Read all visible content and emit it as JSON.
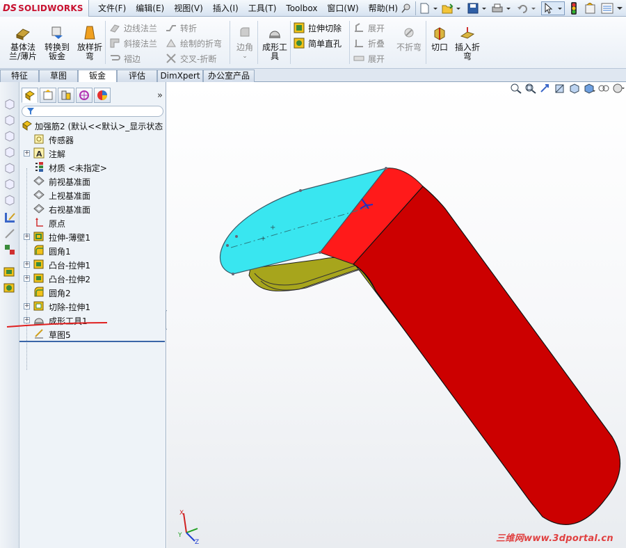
{
  "app": {
    "logo_ds": "DS",
    "logo_name": "SOLIDWORKS"
  },
  "menu": [
    "文件(F)",
    "编辑(E)",
    "视图(V)",
    "插入(I)",
    "工具(T)",
    "Toolbox",
    "窗口(W)",
    "帮助(H)"
  ],
  "commands": {
    "big": [
      {
        "label": "基体法\n兰/薄片",
        "icon": "base-flange-icon"
      },
      {
        "label": "转换到\n钣金",
        "icon": "convert-to-sheet-metal-icon"
      },
      {
        "label": "放样折\n弯",
        "icon": "lofted-bend-icon"
      },
      {
        "label": "边角",
        "icon": "corners-icon"
      },
      {
        "label": "成形工\n具",
        "icon": "forming-tool-icon"
      },
      {
        "label": "切口",
        "icon": "rip-icon"
      },
      {
        "label": "插入折\n弯",
        "icon": "insert-bends-icon"
      }
    ],
    "small": {
      "edge_flange": "边线法兰",
      "miter_flange": "斜接法兰",
      "hem": "褶边",
      "jog": "转折",
      "sketched_bend": "绘制的折弯",
      "cross_break": "交叉-折断",
      "extruded_cut": "拉伸切除",
      "simple_hole": "简单直孔",
      "unfold": "展开",
      "fold": "折叠",
      "flatten": "展开",
      "no_bends": "不折弯"
    }
  },
  "tabs": [
    "特征",
    "草图",
    "钣金",
    "评估",
    "DimXpert",
    "办公室产品"
  ],
  "active_tab": "钣金",
  "feature_tree": {
    "expand_glyph": "»",
    "root": "加强筋2 (默认<<默认>_显示状态",
    "items": [
      {
        "label": "传感器",
        "icon": "sensor-icon",
        "expandable": false
      },
      {
        "label": "注解",
        "icon": "annotation-icon",
        "expandable": true
      },
      {
        "label": "材质 <未指定>",
        "icon": "material-icon",
        "expandable": false
      },
      {
        "label": "前视基准面",
        "icon": "plane-icon",
        "expandable": false
      },
      {
        "label": "上视基准面",
        "icon": "plane-icon",
        "expandable": false
      },
      {
        "label": "右视基准面",
        "icon": "plane-icon",
        "expandable": false
      },
      {
        "label": "原点",
        "icon": "origin-icon",
        "expandable": false
      },
      {
        "label": "拉伸-薄壁1",
        "icon": "extrude-thin-icon",
        "expandable": true
      },
      {
        "label": "圆角1",
        "icon": "fillet-icon",
        "expandable": false
      },
      {
        "label": "凸台-拉伸1",
        "icon": "boss-extrude-icon",
        "expandable": true
      },
      {
        "label": "凸台-拉伸2",
        "icon": "boss-extrude-icon",
        "expandable": true
      },
      {
        "label": "圆角2",
        "icon": "fillet-icon",
        "expandable": false
      },
      {
        "label": "切除-拉伸1",
        "icon": "cut-extrude-icon",
        "expandable": true
      },
      {
        "label": "成形工具1",
        "icon": "forming-tool-icon",
        "expandable": true
      },
      {
        "label": "草图5",
        "icon": "sketch-icon",
        "expandable": false
      }
    ]
  },
  "triad": {
    "x": "X",
    "y": "Y",
    "z": "Z"
  },
  "watermark": "三维网www.3dportal.cn",
  "colors": {
    "face_cyan": "#39e6f0",
    "face_red": "#cc0000",
    "face_red_bright": "#ff1a1a",
    "underside_olive": "#a7a51c",
    "accent_blue": "#3a66a8"
  }
}
